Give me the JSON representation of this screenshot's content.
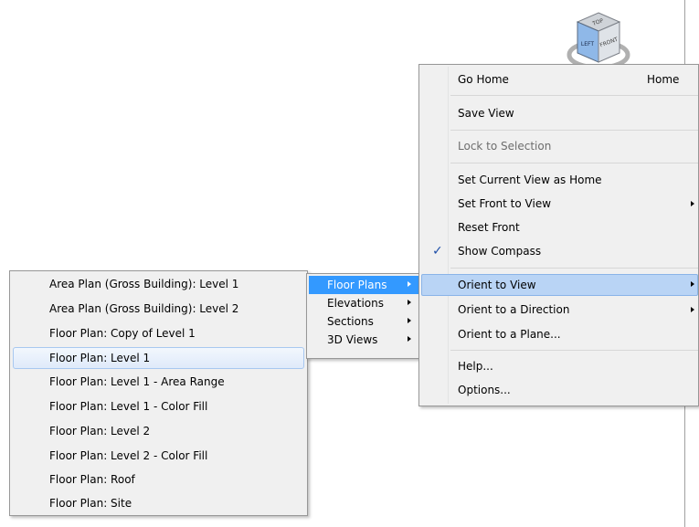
{
  "view_cube": {
    "faces": {
      "top": "TOP",
      "left": "LEFT",
      "front": "FRONT"
    },
    "icon": "view-cube-icon"
  },
  "main_menu": {
    "items": [
      {
        "label": "Go Home",
        "shortcut": "Home",
        "state": "normal"
      },
      {
        "label": "Save View",
        "state": "normal"
      },
      {
        "label": "Lock to Selection",
        "state": "disabled"
      },
      {
        "label": "Set Current View as Home",
        "state": "normal"
      },
      {
        "label": "Set Front to View",
        "state": "submenu"
      },
      {
        "label": "Reset Front",
        "state": "normal"
      },
      {
        "label": "Show Compass",
        "state": "checked",
        "check": "✓"
      },
      {
        "label": "Orient to View",
        "state": "submenu-open"
      },
      {
        "label": "Orient to a Direction",
        "state": "submenu"
      },
      {
        "label": "Orient to a Plane...",
        "state": "normal"
      },
      {
        "label": "Help...",
        "state": "normal"
      },
      {
        "label": "Options...",
        "state": "normal"
      }
    ]
  },
  "view_type_menu": {
    "items": [
      {
        "label": "Floor Plans",
        "state": "selected"
      },
      {
        "label": "Elevations"
      },
      {
        "label": "Sections"
      },
      {
        "label": "3D Views"
      }
    ]
  },
  "floor_plans_menu": {
    "items": [
      {
        "label": "Area Plan (Gross Building): Level 1"
      },
      {
        "label": "Area Plan (Gross Building): Level 2"
      },
      {
        "label": "Floor Plan: Copy of Level 1"
      },
      {
        "label": "Floor Plan: Level 1",
        "state": "hover"
      },
      {
        "label": "Floor Plan: Level 1 - Area Range"
      },
      {
        "label": "Floor Plan: Level 1 - Color Fill"
      },
      {
        "label": "Floor Plan: Level 2"
      },
      {
        "label": "Floor Plan: Level 2 - Color Fill"
      },
      {
        "label": "Floor Plan: Roof"
      },
      {
        "label": "Floor Plan: Site"
      }
    ]
  },
  "colors": {
    "menu_bg": "#f0f0f0",
    "highlight_blue": "#3399ff",
    "hover_border": "#a8c8f0",
    "check": "#1f4fa8"
  }
}
